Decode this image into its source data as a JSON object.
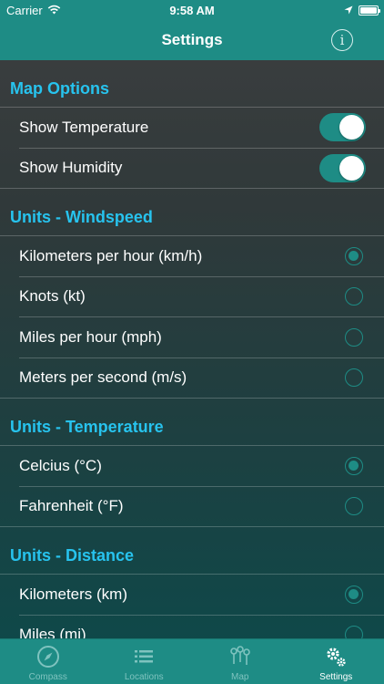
{
  "status_bar": {
    "carrier": "Carrier",
    "time": "9:58 AM",
    "wifi_icon": "wifi-icon",
    "location_icon": "location-arrow-icon",
    "battery_icon": "battery-icon"
  },
  "nav": {
    "title": "Settings",
    "info_label": "i"
  },
  "sections": {
    "map_options": {
      "title": "Map Options",
      "show_temperature": {
        "label": "Show Temperature",
        "on": true
      },
      "show_humidity": {
        "label": "Show Humidity",
        "on": true
      }
    },
    "windspeed": {
      "title": "Units - Windspeed",
      "kmh": {
        "label": "Kilometers per hour (km/h)",
        "selected": true
      },
      "kt": {
        "label": "Knots (kt)",
        "selected": false
      },
      "mph": {
        "label": "Miles per hour (mph)",
        "selected": false
      },
      "ms": {
        "label": "Meters per second (m/s)",
        "selected": false
      }
    },
    "temperature": {
      "title": "Units - Temperature",
      "celcius": {
        "label": "Celcius (°C)",
        "selected": true
      },
      "fahrenheit": {
        "label": "Fahrenheit (°F)",
        "selected": false
      }
    },
    "distance": {
      "title": "Units - Distance",
      "km": {
        "label": "Kilometers (km)",
        "selected": true
      },
      "mi": {
        "label": "Miles (mi)",
        "selected": false
      }
    }
  },
  "tabs": {
    "compass": {
      "label": "Compass",
      "icon": "compass-icon"
    },
    "locations": {
      "label": "Locations",
      "icon": "list-icon"
    },
    "map": {
      "label": "Map",
      "icon": "map-pins-icon"
    },
    "settings": {
      "label": "Settings",
      "icon": "gears-icon",
      "active": true
    }
  },
  "colors": {
    "accent": "#1e8c85",
    "section_header": "#27c3ee",
    "tab_inactive": "#7fc3bf"
  }
}
